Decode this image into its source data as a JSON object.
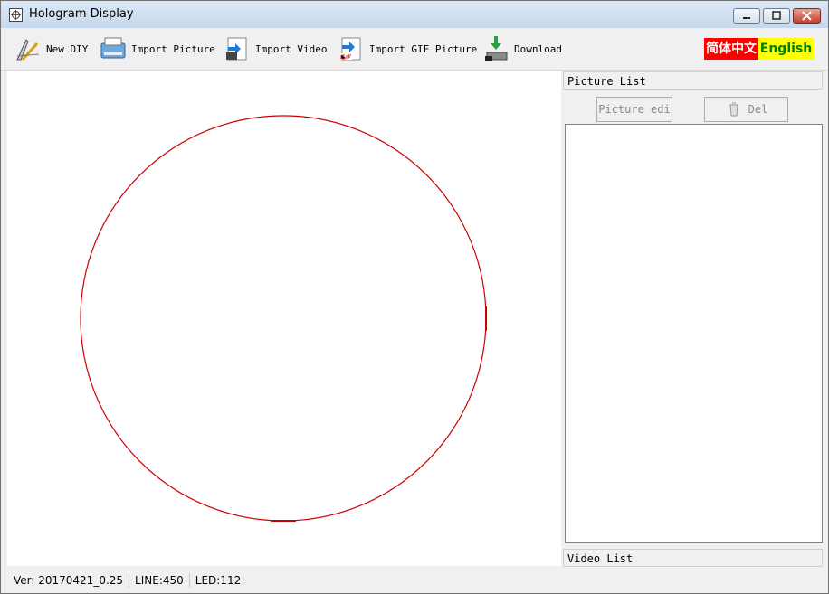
{
  "window": {
    "title": "Hologram Display"
  },
  "toolbar": {
    "new_diy": "New DIY",
    "import_picture": "Import Picture",
    "import_video": "Import Video",
    "import_gif": "Import GIF Picture",
    "download": "Download"
  },
  "language": {
    "chinese": "简体中文",
    "english": "English"
  },
  "panel": {
    "picture_list_title": "Picture List",
    "picture_edit_button": "Picture edi",
    "delete_button": "Del",
    "video_list_title": "Video List"
  },
  "status": {
    "version": "Ver: 20170421_0.25",
    "line": "LINE:450",
    "led": "LED:112"
  },
  "colors": {
    "circle_stroke": "#cc0000",
    "lang_cn_bg": "#ff0000",
    "lang_en_bg": "#ffff00",
    "lang_en_text": "#008000"
  },
  "icons": [
    "app-icon",
    "new-diy-icon",
    "import-picture-icon",
    "import-video-icon",
    "import-gif-icon",
    "download-icon",
    "recycle-icon",
    "minimize-icon",
    "maximize-icon",
    "close-icon"
  ]
}
